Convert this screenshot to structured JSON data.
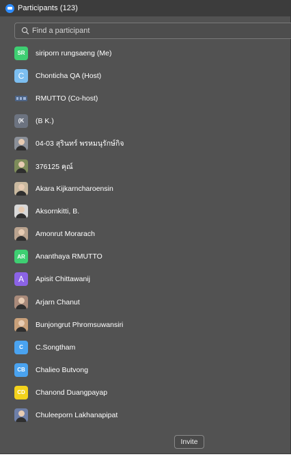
{
  "window": {
    "title": "Participants (123)"
  },
  "search": {
    "placeholder": "Find a participant"
  },
  "participants": [
    {
      "name": "siriporn rungsaeng (Me)",
      "avatar_text": "SR",
      "avatar_color": "#3ecf72",
      "avatar_type": "initials"
    },
    {
      "name": "Chonticha QA (Host)",
      "avatar_text": "C",
      "avatar_color": "#7cbef0",
      "avatar_type": "initials-big"
    },
    {
      "name": "RMUTTO (Co-host)",
      "avatar_text": "",
      "avatar_color": "#5a6e8a",
      "avatar_type": "logo"
    },
    {
      "name": "(B K.)",
      "avatar_text": "(K",
      "avatar_color": "#6c7380",
      "avatar_type": "initials"
    },
    {
      "name": "04-03 สุรินทร์ พรหมนุรักษ์กิจ",
      "avatar_text": "",
      "avatar_color": "#8a8f98",
      "avatar_type": "photo"
    },
    {
      "name": "376125 คุณ์",
      "avatar_text": "",
      "avatar_color": "#7d8c5a",
      "avatar_type": "photo"
    },
    {
      "name": "Akara Kijkarncharoensin",
      "avatar_text": "",
      "avatar_color": "#c9b9a0",
      "avatar_type": "photo"
    },
    {
      "name": "Aksornkitti, B.",
      "avatar_text": "",
      "avatar_color": "#d8d8d8",
      "avatar_type": "photo"
    },
    {
      "name": "Amonrut Morarach",
      "avatar_text": "",
      "avatar_color": "#b9a38f",
      "avatar_type": "photo"
    },
    {
      "name": "Ananthaya RMUTTO",
      "avatar_text": "AR",
      "avatar_color": "#3ecf72",
      "avatar_type": "initials"
    },
    {
      "name": "Apisit Chittawanij",
      "avatar_text": "A",
      "avatar_color": "#8b63e6",
      "avatar_type": "initials-big"
    },
    {
      "name": "Arjarn Chanut",
      "avatar_text": "",
      "avatar_color": "#a88a7a",
      "avatar_type": "photo"
    },
    {
      "name": "Bunjongrut Phromsuwansiri",
      "avatar_text": "",
      "avatar_color": "#c8a07a",
      "avatar_type": "photo"
    },
    {
      "name": "C.Songtham",
      "avatar_text": "C",
      "avatar_color": "#4aa3f0",
      "avatar_type": "initials"
    },
    {
      "name": "Chalieo Butvong",
      "avatar_text": "CB",
      "avatar_color": "#4aa3f0",
      "avatar_type": "initials"
    },
    {
      "name": "Chanond Duangpayap",
      "avatar_text": "CD",
      "avatar_color": "#f3d21c",
      "avatar_type": "initials"
    },
    {
      "name": "Chuleeporn Lakhanapipat",
      "avatar_text": "",
      "avatar_color": "#6e7fa8",
      "avatar_type": "photo"
    }
  ],
  "footer": {
    "invite_label": "Invite"
  }
}
